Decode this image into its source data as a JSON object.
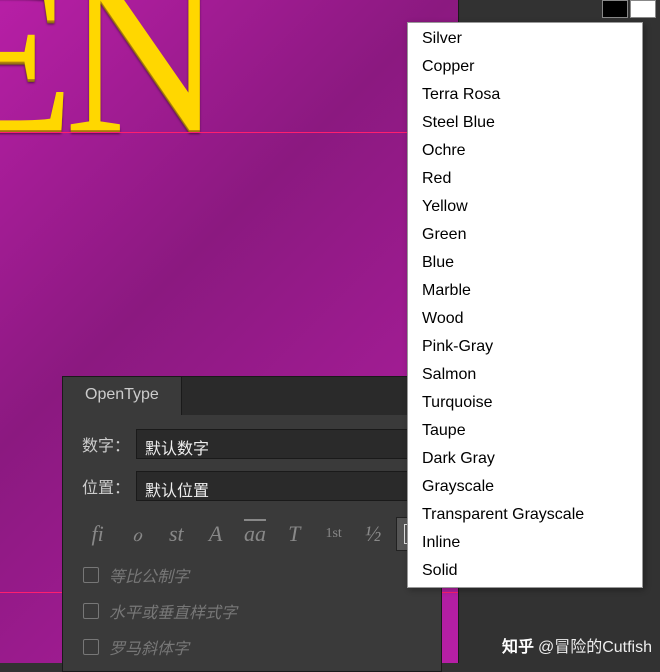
{
  "canvas": {
    "text_fragment": "EN"
  },
  "panel": {
    "tab_label": "OpenType",
    "fields": {
      "numerals_label": "数字：",
      "numerals_value": "默认数字",
      "position_label": "位置：",
      "position_value": "默认位置"
    },
    "buttons": {
      "ligature": "fi",
      "swash": "ℴ",
      "stylistic": "st",
      "alternates": "A",
      "contextual": "aa",
      "titling": "T",
      "ordinals": "1st",
      "fractions": "½",
      "boxed": "a"
    },
    "checkboxes": {
      "proportional_metrics": "等比公制字",
      "h_or_v_style": "水平或垂直样式字",
      "roman_italics": "罗马斜体字"
    }
  },
  "dropdown": {
    "items": [
      "Silver",
      "Copper",
      "Terra Rosa",
      "Steel Blue",
      "Ochre",
      "Red",
      "Yellow",
      "Green",
      "Blue",
      "Marble",
      "Wood",
      "Pink-Gray",
      "Salmon",
      "Turquoise",
      "Taupe",
      "Dark Gray",
      "Grayscale",
      "Transparent Grayscale",
      "Inline",
      "Solid"
    ]
  },
  "watermark": {
    "logo": "知乎",
    "text": "@冒险的Cutfish"
  }
}
